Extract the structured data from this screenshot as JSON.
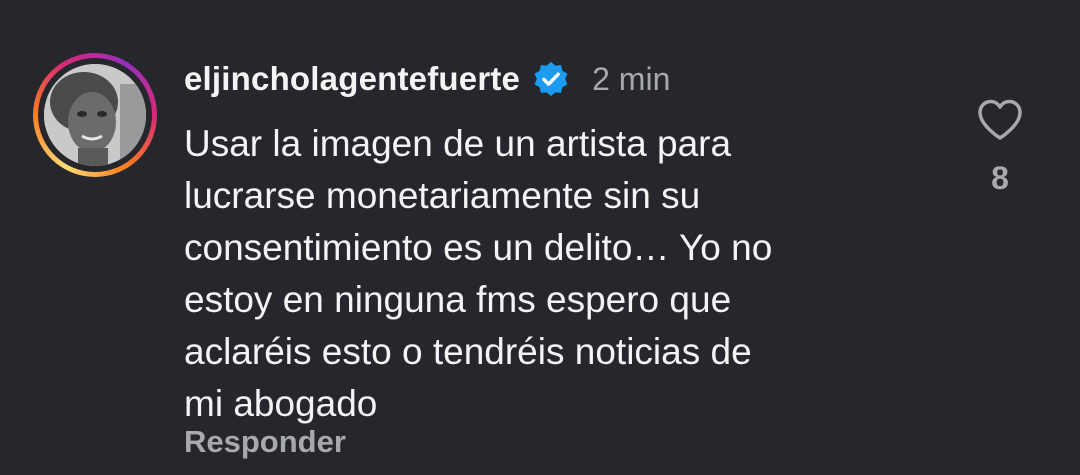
{
  "comment": {
    "username": "eljincholagentefuerte",
    "timestamp": "2 min",
    "verified": true,
    "lines": [
      "Usar la imagen de un artista para",
      "lucrarse monetariamente sin su",
      "consentimiento es un delito… Yo no",
      "estoy en ninguna fms espero que",
      "aclaréis esto o tendréis noticias de",
      "mi abogado"
    ],
    "reply_label": "Responder",
    "like_count": "8"
  },
  "icons": {
    "verified": "verified-badge-icon",
    "like": "heart-outline-icon"
  },
  "colors": {
    "background": "#25272c",
    "text": "#f4f4f5",
    "muted": "#a7a9ae",
    "verified": "#1d9bf0"
  }
}
